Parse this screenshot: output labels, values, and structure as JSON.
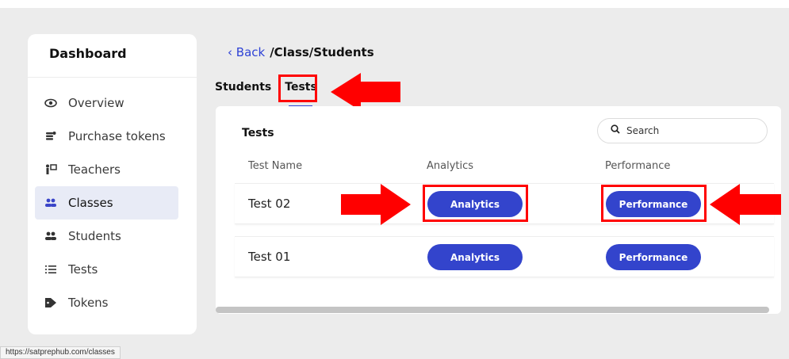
{
  "sidebar": {
    "title": "Dashboard",
    "items": [
      {
        "label": "Overview",
        "icon": "eye-icon",
        "active": false
      },
      {
        "label": "Purchase tokens",
        "icon": "coins-icon",
        "active": false
      },
      {
        "label": "Teachers",
        "icon": "teacher-icon",
        "active": false
      },
      {
        "label": "Classes",
        "icon": "users-icon",
        "active": true
      },
      {
        "label": "Students",
        "icon": "users-icon",
        "active": false
      },
      {
        "label": "Tests",
        "icon": "list-icon",
        "active": false
      },
      {
        "label": "Tokens",
        "icon": "tag-icon",
        "active": false
      }
    ]
  },
  "header": {
    "back_label": "Back",
    "path": "/Class/Students"
  },
  "tabs": [
    {
      "label": "Students"
    },
    {
      "label": "Tests",
      "active": true
    }
  ],
  "card": {
    "title": "Tests",
    "search_placeholder": "Search",
    "columns": [
      "Test Name",
      "Analytics",
      "Performance"
    ],
    "rows": [
      {
        "name": "Test 02",
        "analytics_label": "Analytics",
        "performance_label": "Performance"
      },
      {
        "name": "Test 01",
        "analytics_label": "Analytics",
        "performance_label": "Performance"
      }
    ]
  },
  "status_bar": {
    "url": "https://satprephub.com/classes"
  },
  "colors": {
    "accent": "#3344cc",
    "link": "#2f43d6",
    "annotation": "#ff0000",
    "active_nav_bg": "#e8ebf6"
  }
}
